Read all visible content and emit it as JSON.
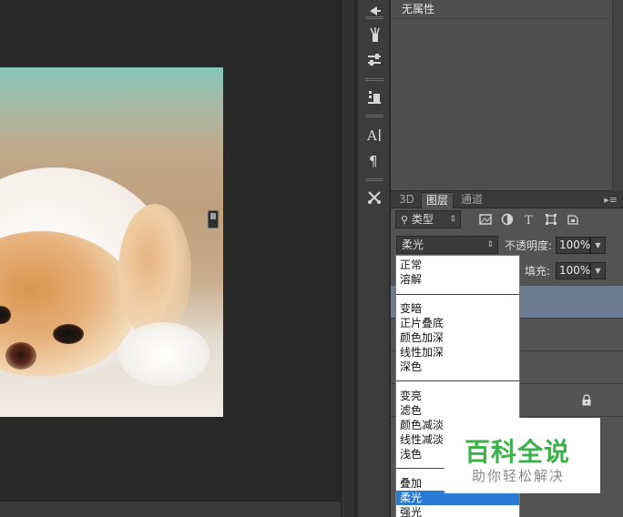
{
  "properties": {
    "text": "无属性"
  },
  "tabs": [
    {
      "label": "3D"
    },
    {
      "label": "图层"
    },
    {
      "label": "通道"
    }
  ],
  "layers_panel": {
    "filter_kind_label": "类型",
    "blend_mode_value": "柔光",
    "opacity_label": "不透明度:",
    "opacity_value": "100%",
    "fill_label": "填充:",
    "fill_value": "100%"
  },
  "blend_modes": {
    "group1": [
      "正常",
      "溶解"
    ],
    "group2": [
      "变暗",
      "正片叠底",
      "颜色加深",
      "线性加深",
      "深色"
    ],
    "group3": [
      "变亮",
      "滤色",
      "颜色减淡",
      "线性减淡",
      "浅色"
    ],
    "group4": [
      "叠加",
      "柔光",
      "强光"
    ],
    "selected": "柔光"
  },
  "watermark": {
    "title": "百科全说",
    "subtitle": "助你轻松解决"
  },
  "colors": {
    "selection": "#2a7bd6",
    "active_layer": "#6c7a92",
    "watermark_green": "#3bb14a"
  }
}
